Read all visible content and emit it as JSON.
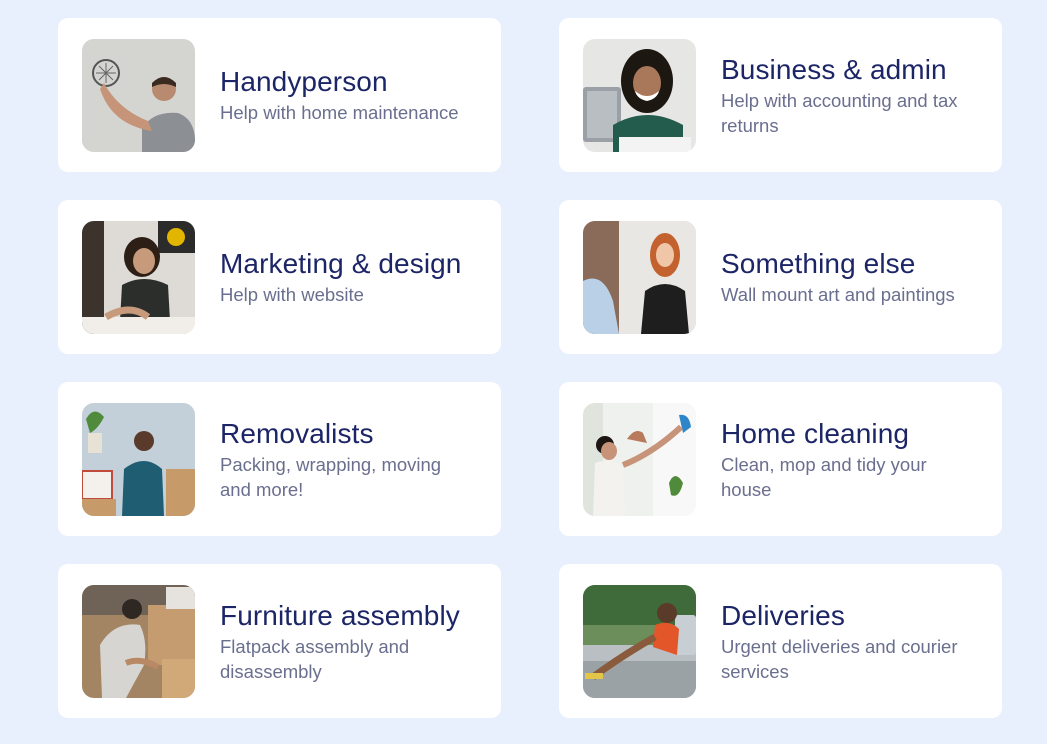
{
  "services": [
    {
      "id": "handyperson",
      "title": "Handyperson",
      "description": "Help with home maintenance",
      "image": "handyperson-photo-icon"
    },
    {
      "id": "business-admin",
      "title": "Business & admin",
      "description": "Help with accounting and tax returns",
      "image": "business-photo-icon"
    },
    {
      "id": "marketing-design",
      "title": "Marketing & design",
      "description": "Help with website",
      "image": "marketing-photo-icon"
    },
    {
      "id": "something-else",
      "title": "Something else",
      "description": "Wall mount art and paintings",
      "image": "something-else-photo-icon"
    },
    {
      "id": "removalists",
      "title": "Removalists",
      "description": "Packing, wrapping, moving and more!",
      "image": "removalists-photo-icon"
    },
    {
      "id": "home-cleaning",
      "title": "Home cleaning",
      "description": "Clean, mop and tidy your house",
      "image": "cleaning-photo-icon"
    },
    {
      "id": "furniture-assembly",
      "title": "Furniture assembly",
      "description": "Flatpack assembly and disassembly",
      "image": "furniture-photo-icon"
    },
    {
      "id": "deliveries",
      "title": "Deliveries",
      "description": "Urgent deliveries and courier services",
      "image": "deliveries-photo-icon"
    }
  ]
}
